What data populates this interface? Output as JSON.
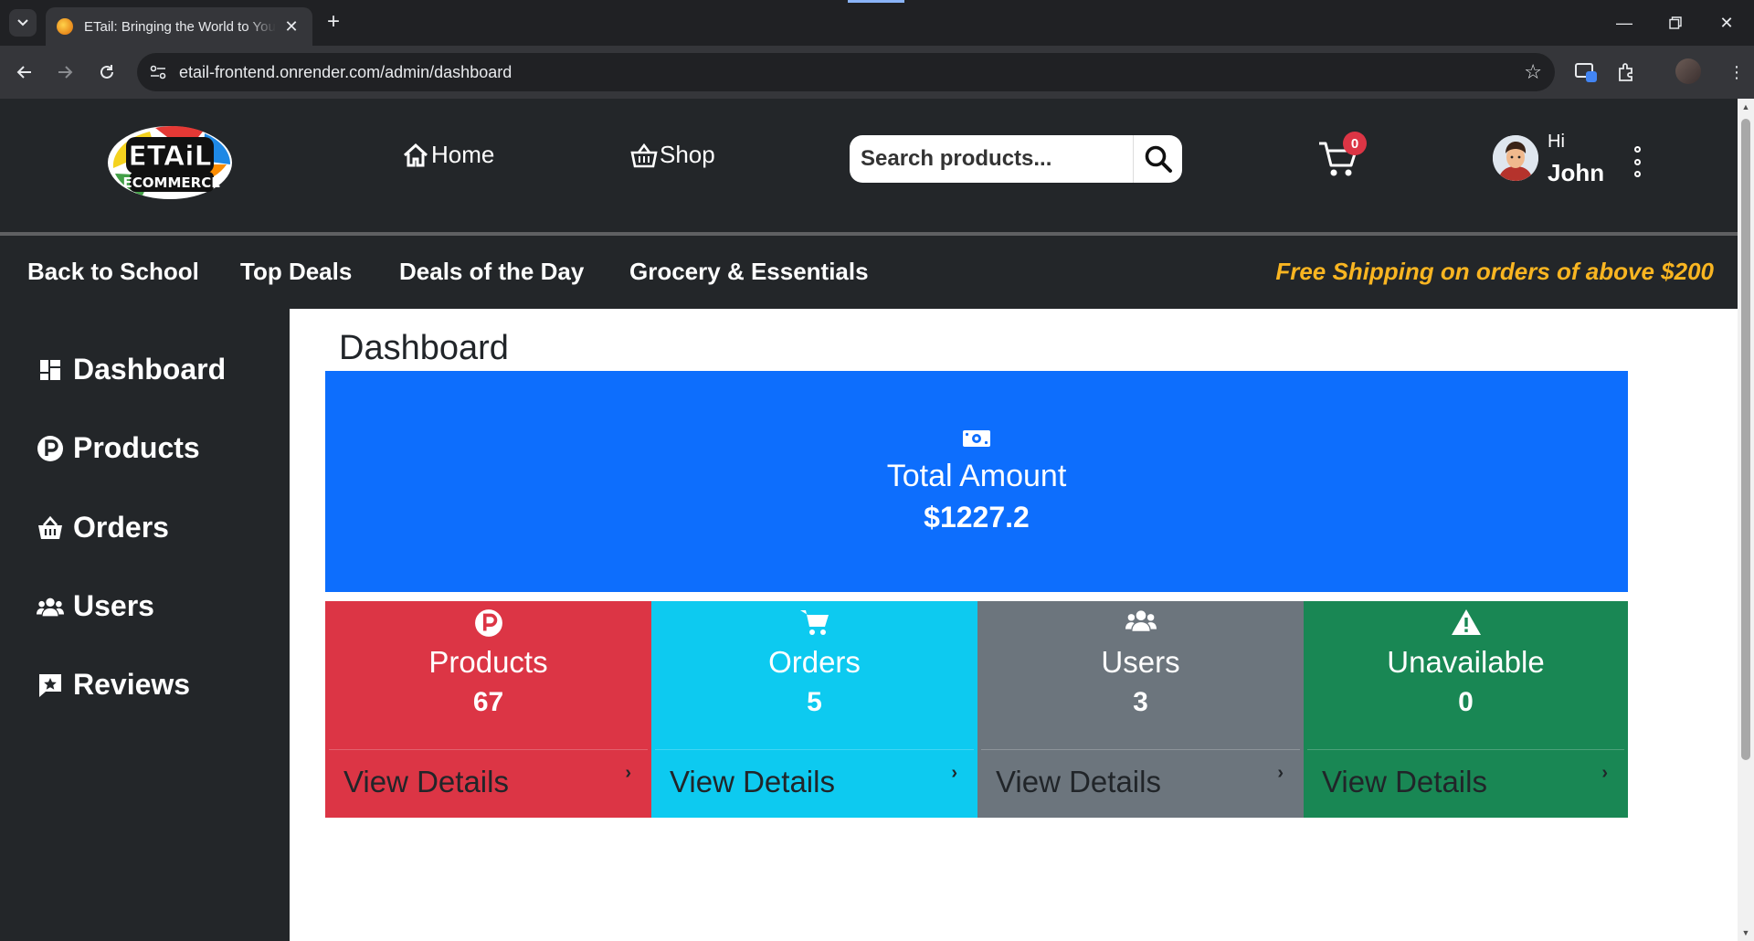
{
  "browser": {
    "tab_title": "ETail: Bringing the World to Your Door",
    "url": "etail-frontend.onrender.com/admin/dashboard"
  },
  "header": {
    "logo_text": "ETAIL ECOMMERCE",
    "nav": [
      {
        "label": "Home",
        "icon": "home-icon"
      },
      {
        "label": "Shop",
        "icon": "basket-icon"
      }
    ],
    "search": {
      "placeholder": "Search products..."
    },
    "cart_count": "0",
    "greeting": "Hi",
    "user_name": "John"
  },
  "subnav": {
    "links": [
      "Back to School",
      "Top Deals",
      "Deals of the Day",
      "Grocery & Essentials"
    ],
    "promo": "Free Shipping on orders of above $200"
  },
  "sidebar": {
    "items": [
      {
        "label": "Dashboard",
        "icon": "dashboard-icon"
      },
      {
        "label": "Products",
        "icon": "product-p-icon"
      },
      {
        "label": "Orders",
        "icon": "basket-icon"
      },
      {
        "label": "Users",
        "icon": "users-icon"
      },
      {
        "label": "Reviews",
        "icon": "review-icon"
      }
    ]
  },
  "dashboard": {
    "title": "Dashboard",
    "total": {
      "label": "Total Amount",
      "value": "$1227.2",
      "icon": "money-icon",
      "color": "#0d6efd"
    },
    "cards": [
      {
        "label": "Products",
        "value": "67",
        "link": "View Details",
        "icon": "product-p-icon",
        "color": "#dc3545"
      },
      {
        "label": "Orders",
        "value": "5",
        "link": "View Details",
        "icon": "cart-icon",
        "color": "#0dcaf0"
      },
      {
        "label": "Users",
        "value": "3",
        "link": "View Details",
        "icon": "users-icon",
        "color": "#6c757d"
      },
      {
        "label": "Unavailable",
        "value": "0",
        "link": "View Details",
        "icon": "warning-icon",
        "color": "#198754"
      }
    ]
  }
}
